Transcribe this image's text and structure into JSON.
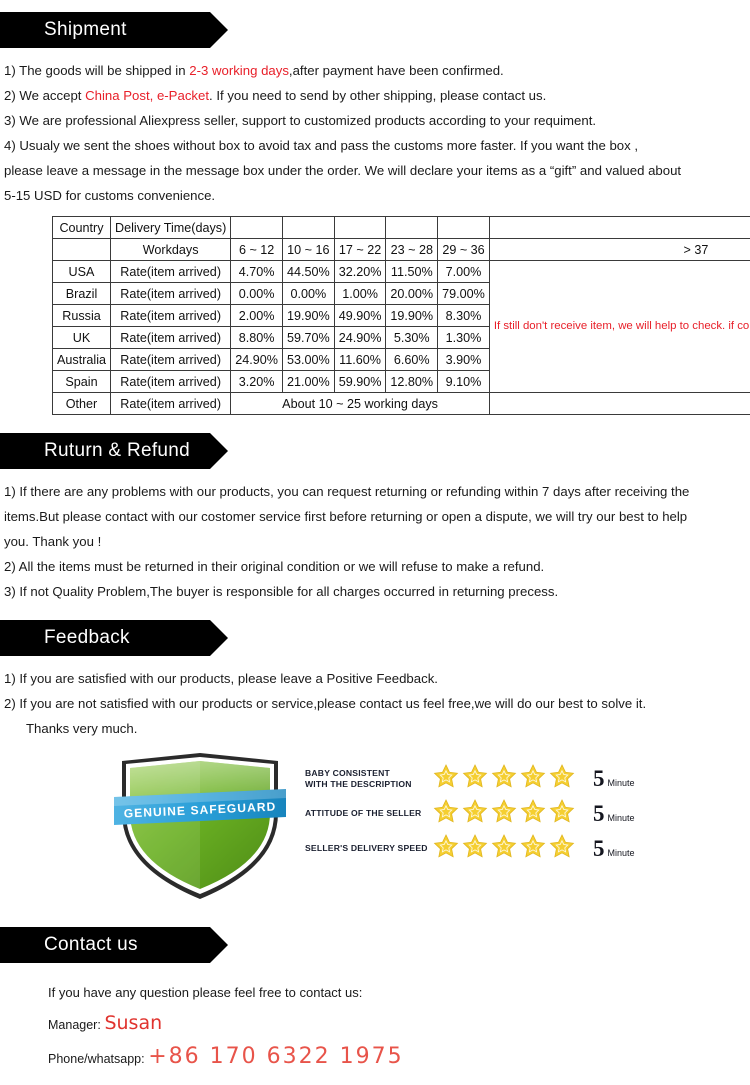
{
  "sections": {
    "shipment": {
      "banner": "Shipment",
      "lines": [
        {
          "id": "s1",
          "parts": [
            {
              "t": "1) The goods will be shipped in ",
              "hl": false
            },
            {
              "t": "2-3 working days",
              "hl": true
            },
            {
              "t": ",after payment have been confirmed.",
              "hl": false
            }
          ]
        },
        {
          "id": "s2",
          "parts": [
            {
              "t": "2) We accept ",
              "hl": false
            },
            {
              "t": "China Post, e-Packet",
              "hl": true
            },
            {
              "t": ". If you need to send by other shipping, please contact us.",
              "hl": false
            }
          ]
        },
        {
          "id": "s3",
          "parts": [
            {
              "t": "3) We are professional Aliexpress seller, support to customized products according to your requiment.",
              "hl": false
            }
          ]
        },
        {
          "id": "s4",
          "parts": [
            {
              "t": "4) Usualy we sent the shoes without box to avoid tax and pass the customs more faster. If you want the box ,",
              "hl": false
            }
          ]
        },
        {
          "id": "s5",
          "parts": [
            {
              "t": "please leave a message in the message box under the order. We will declare your items as a “gift” and valued about",
              "hl": false
            }
          ]
        },
        {
          "id": "s6",
          "parts": [
            {
              "t": "5-15 USD for customs convenience.",
              "hl": false
            }
          ]
        }
      ]
    },
    "returns": {
      "banner": "Ruturn & Refund",
      "lines": [
        "1) If there are any problems with our products, you can request returning or refunding within 7 days after receiving the",
        "items.But please contact with our costomer service first before returning or open a dispute, we will try our best to help",
        "you. Thank you !",
        "2) All the items must be returned in their original condition or we will refuse to make a refund.",
        "3) If not Quality Problem,The buyer is responsible for all charges occurred in returning precess."
      ]
    },
    "feedback": {
      "banner": "Feedback",
      "lines": [
        "1) If you are satisfied with our products, please leave a Positive Feedback.",
        "2) If you are not satisfied with our products or service,please contact us feel free,we will do our best to solve it.",
        "Thanks very much."
      ]
    },
    "contact": {
      "banner": "Contact us",
      "intro": "If you have any question please feel free to contact us:",
      "manager_label": "Manager:",
      "manager_name": "Susan",
      "phone_label": "Phone/whatsapp:",
      "phone_number": "+86 170 6322 1975"
    }
  },
  "shipping_table": {
    "header_row_1": [
      "Country",
      "Delivery Time(days)",
      "",
      "",
      "",
      "",
      "",
      ""
    ],
    "header_row_2": [
      "",
      "Workdays",
      "6 ~ 12",
      "10 ~ 16",
      "17 ~ 22",
      "23 ~ 28",
      "29 ~ 36",
      "> 37"
    ],
    "rows": [
      {
        "country": "USA",
        "metric": "Rate(item arrived)",
        "values": [
          "4.70%",
          "44.50%",
          "32.20%",
          "11.50%",
          "7.00%"
        ]
      },
      {
        "country": "Brazil",
        "metric": "Rate(item arrived)",
        "values": [
          "0.00%",
          "0.00%",
          "1.00%",
          "20.00%",
          "79.00%"
        ]
      },
      {
        "country": "Russia",
        "metric": "Rate(item arrived)",
        "values": [
          "2.00%",
          "19.90%",
          "49.90%",
          "19.90%",
          "8.30%"
        ]
      },
      {
        "country": "UK",
        "metric": "Rate(item arrived)",
        "values": [
          "8.80%",
          "59.70%",
          "24.90%",
          "5.30%",
          "1.30%"
        ]
      },
      {
        "country": "Australia",
        "metric": "Rate(item arrived)",
        "values": [
          "24.90%",
          "53.00%",
          "11.60%",
          "6.60%",
          "3.90%"
        ]
      },
      {
        "country": "Spain",
        "metric": "Rate(item arrived)",
        "values": [
          "3.20%",
          "21.00%",
          "59.90%",
          "12.80%",
          "9.10%"
        ]
      }
    ],
    "other_row": {
      "country": "Other",
      "metric": "Rate(item arrived)",
      "span_text": "About 10 ~ 25 working days"
    },
    "note": "If still don't receive item, we will help to check. if confirm lost we will resend item.",
    "note_color": "#e8202a"
  },
  "trust": {
    "shield": {
      "banner_left": "GENUINE",
      "banner_right": "SAFEGUARD",
      "shield_color": "#6ab023",
      "ribbon_color": "#2a9fd8"
    },
    "ratings": [
      {
        "label_lines": [
          "BABY  CONSISTENT",
          "WITH THE DESCRIPTION"
        ],
        "stars": 5,
        "score": "5",
        "unit": "Minute"
      },
      {
        "label_lines": [
          "ATTITUDE OF THE SELLER"
        ],
        "stars": 5,
        "score": "5",
        "unit": "Minute"
      },
      {
        "label_lines": [
          "SELLER'S DELIVERY SPEED"
        ],
        "stars": 5,
        "score": "5",
        "unit": "Minute"
      }
    ],
    "star_color": "#f5cf31"
  },
  "colors": {
    "banner_bg": "#000000",
    "banner_text": "#ffffff",
    "highlight_red": "#e8202a",
    "body_text": "#1a1a1a"
  }
}
